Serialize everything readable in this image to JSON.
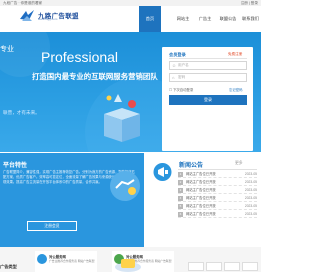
{
  "topbar": {
    "left": "九段广告 · 你是谁的看家",
    "right": "注册 | 登录"
  },
  "header": {
    "brand": "九路广告联盟",
    "brand_url": "www.9lgg.com",
    "nav": [
      "首页",
      "网站主",
      "广告主",
      "联盟公告",
      "联系我们"
    ]
  },
  "banner": {
    "prefix": "专业",
    "title": "Professional",
    "slogan": "打造国内最专业的互联网服务营销团队",
    "footer": "联营，才有未来。"
  },
  "login": {
    "title": "会员登录",
    "register": "免费注册",
    "user_placeholder": "用户名",
    "pass_placeholder": "密码",
    "remember": "下次自动登录",
    "forgot": "忘记密码",
    "submit": "登录"
  },
  "features": {
    "title": "平台特性",
    "desc": "广告联盟简介，兼容性强，实现广告主推荐恢复广告。分别为我方的广告资源，智能投放匹配方案，优质广告客户。效率高可靠定位，全面流量了解广告效果与来源统计，帮助我们实现效果。提高广告主流量在开放平台体系中的广告质量，合作共赢。",
    "button": "注册会员"
  },
  "news": {
    "title": "新闻公告",
    "more": "更多",
    "items": [
      {
        "num": "1",
        "text": "网站主广告位已开放",
        "date": "2023-05"
      },
      {
        "num": "2",
        "text": "网站主广告位已开放",
        "date": "2023-05"
      },
      {
        "num": "3",
        "text": "网站主广告位已开放",
        "date": "2023-05"
      },
      {
        "num": "4",
        "text": "网站主广告位已开放",
        "date": "2023-05"
      },
      {
        "num": "5",
        "text": "网站主广告位已开放",
        "date": "2023-05"
      },
      {
        "num": "6",
        "text": "网站主广告位已开放",
        "date": "2023-05"
      }
    ]
  },
  "lower": {
    "heading": "广告类型",
    "cards": [
      {
        "name": "对公服务网",
        "text": "广告主推荐合作服务商 网站广告联盟"
      },
      {
        "name": "对公服务网",
        "text": "广告主推荐合作服务商 网站广告联盟"
      }
    ]
  }
}
